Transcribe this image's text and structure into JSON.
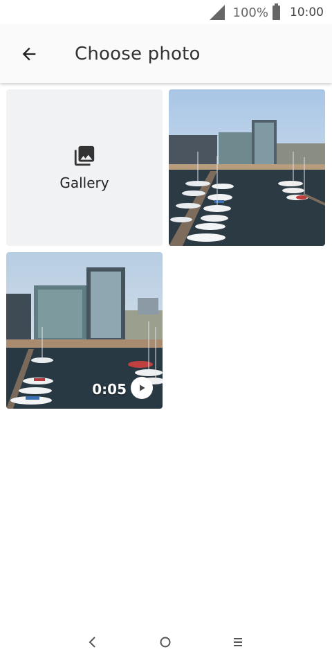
{
  "status_bar": {
    "battery": "100%",
    "time": "10:00",
    "icons": [
      "signal-icon",
      "battery-icon"
    ]
  },
  "app_bar": {
    "title": "Choose photo",
    "back_icon": "arrow-back-icon"
  },
  "grid": {
    "gallery": {
      "label": "Gallery",
      "icon": "photo-library-icon"
    },
    "items": [
      {
        "type": "photo"
      },
      {
        "type": "video",
        "duration": "0:05",
        "icon": "play-icon"
      }
    ]
  },
  "nav_bar": {
    "icons": [
      "nav-back-icon",
      "nav-home-icon",
      "nav-menu-icon"
    ]
  },
  "colors": {
    "app_bar_bg": "#fafafa",
    "gallery_tile_bg": "#f1f2f4",
    "text_primary": "#222222"
  }
}
